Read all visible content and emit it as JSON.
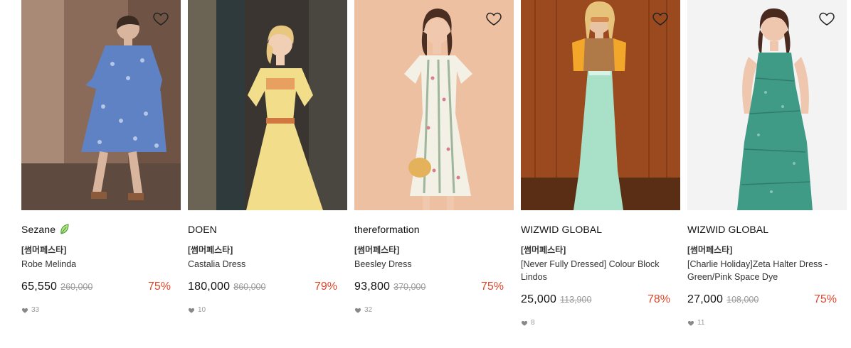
{
  "colors": {
    "discount": "#e0452a",
    "text": "#111111",
    "muted": "#999999"
  },
  "products": [
    {
      "brand": "Sezane",
      "eco_badge": "leaf-icon",
      "tag": "[썸머페스타]",
      "name": "Robe Melinda",
      "price": "65,550",
      "original_price": "260,000",
      "discount": "75%",
      "likes": "33"
    },
    {
      "brand": "DOEN",
      "tag": "[썸머페스타]",
      "name": "Castalia Dress",
      "price": "180,000",
      "original_price": "860,000",
      "discount": "79%",
      "likes": "10"
    },
    {
      "brand": "thereformation",
      "tag": "[썸머페스타]",
      "name": "Beesley Dress",
      "price": "93,800",
      "original_price": "370,000",
      "discount": "75%",
      "likes": "32"
    },
    {
      "brand": "WIZWID GLOBAL",
      "tag": "[썸머페스타]",
      "name": "[Never Fully Dressed] Colour Block Lindos",
      "price": "25,000",
      "original_price": "113,900",
      "discount": "78%",
      "likes": "8"
    },
    {
      "brand": "WIZWID GLOBAL",
      "tag": "[썸머페스타]",
      "name": "[Charlie Holiday]Zeta Halter Dress - Green/Pink Space Dye",
      "price": "27,000",
      "original_price": "108,000",
      "discount": "75%",
      "likes": "11"
    }
  ]
}
